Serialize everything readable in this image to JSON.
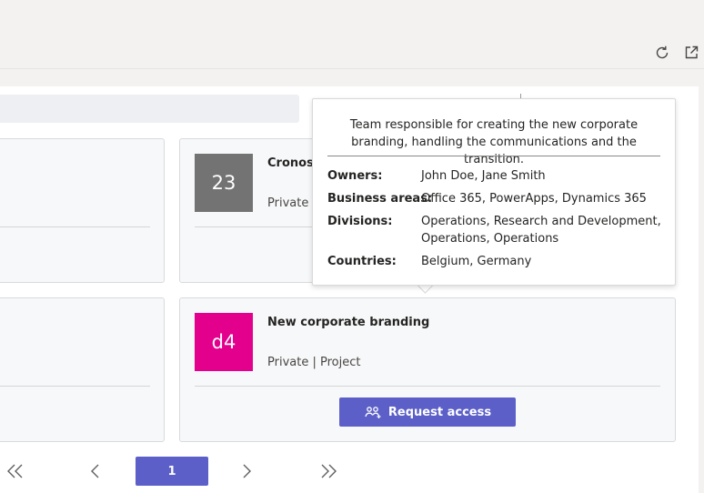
{
  "toolbar": {
    "icons": [
      "refresh-icon",
      "popout-icon"
    ]
  },
  "cards": [
    {
      "tile_text": "23",
      "tile_color": "#737373",
      "title": "Cronos",
      "meta": "Private | "
    },
    {
      "tile_text": "d4",
      "tile_color": "#e3008c",
      "title": "New corporate branding",
      "meta": "Private | Project",
      "button_label": "Request access"
    }
  ],
  "tooltip": {
    "description": "Team responsible for creating the new corporate branding, handling the communications and the transition.",
    "rows": [
      {
        "label": "Owners:",
        "value": "John Doe, Jane Smith"
      },
      {
        "label": "Business areas:",
        "value": "Office 365, PowerApps, Dynamics 365"
      },
      {
        "label": "Divisions:",
        "value": "Operations, Research and Development, Operations, Operations"
      },
      {
        "label": "Countries:",
        "value": "Belgium, Germany"
      }
    ]
  },
  "pagination": {
    "current_page": "1"
  },
  "colors": {
    "accent": "#5b5fc7",
    "background": "#f3f2f1"
  }
}
